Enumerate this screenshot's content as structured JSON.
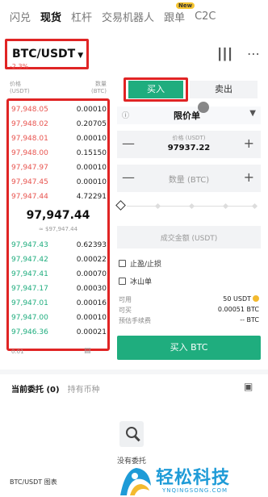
{
  "topnav": {
    "tabs": [
      "闪兑",
      "现货",
      "杠杆",
      "交易机器人",
      "跟单",
      "C2C"
    ],
    "active_index": 1,
    "new_badge": "New"
  },
  "pair": {
    "symbol": "BTC/USDT",
    "change": "-2.3%"
  },
  "orderbook": {
    "header": {
      "price_label": "价格",
      "price_unit": "(USDT)",
      "amount_label": "数量",
      "amount_unit": "(BTC)"
    },
    "asks": [
      {
        "price": "97,948.05",
        "amount": "0.00010"
      },
      {
        "price": "97,948.02",
        "amount": "0.20705"
      },
      {
        "price": "97,948.01",
        "amount": "0.00010"
      },
      {
        "price": "97,948.00",
        "amount": "0.15150"
      },
      {
        "price": "97,947.97",
        "amount": "0.00010"
      },
      {
        "price": "97,947.45",
        "amount": "0.00010"
      },
      {
        "price": "97,947.44",
        "amount": "4.72291"
      }
    ],
    "mid_price": "97,947.44",
    "mid_sub": "≈ $97,947.44",
    "bids": [
      {
        "price": "97,947.43",
        "amount": "0.62393"
      },
      {
        "price": "97,947.42",
        "amount": "0.00022"
      },
      {
        "price": "97,947.41",
        "amount": "0.00070"
      },
      {
        "price": "97,947.17",
        "amount": "0.00030"
      },
      {
        "price": "97,947.01",
        "amount": "0.00016"
      },
      {
        "price": "97,947.00",
        "amount": "0.00010"
      },
      {
        "price": "97,946.36",
        "amount": "0.00021"
      }
    ],
    "depth_step": "0.01"
  },
  "trade": {
    "buy_tab": "买入",
    "sell_tab": "卖出",
    "order_type": "限价单",
    "price_label": "价格 (USDT)",
    "price_value": "97937.22",
    "qty_placeholder": "数量 (BTC)",
    "amount_placeholder": "成交金额 (USDT)",
    "stop_label": "止盈/止损",
    "iceberg_label": "冰山单",
    "available_label": "可用",
    "available_value": "50 USDT",
    "can_buy_label": "可买",
    "can_buy_value": "0.00051 BTC",
    "fee_label": "预估手续费",
    "fee_value": "-- BTC",
    "buy_button": "买入 BTC"
  },
  "bottom": {
    "tab_orders": "当前委托 (0)",
    "tab_holdings": "持有币种",
    "empty_text": "没有委托",
    "chart_link": "BTC/USDT 图表"
  },
  "watermark": {
    "text": "轻松科技",
    "url": "YNQINGSONG.COM"
  },
  "colors": {
    "ask": "#e8544f",
    "bid": "#1fad7e",
    "highlight": "#e02424",
    "watermark": "#1e9bd7"
  }
}
